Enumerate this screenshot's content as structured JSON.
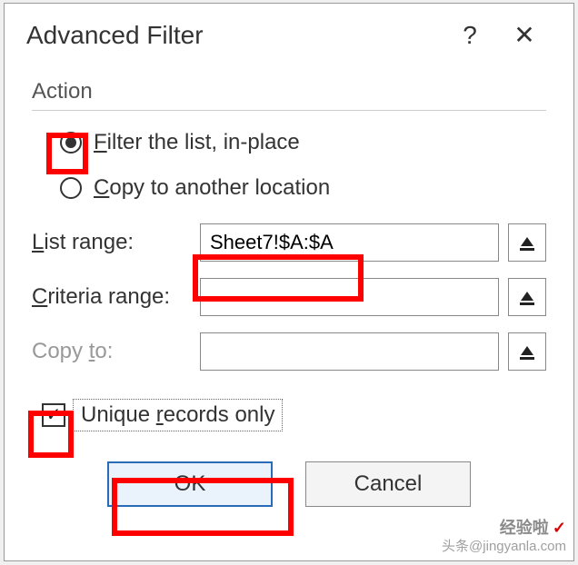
{
  "dialog": {
    "title": "Advanced Filter",
    "help_symbol": "?",
    "close_symbol": "✕"
  },
  "action": {
    "section_label": "Action",
    "filter_in_place": {
      "prefix": "F",
      "rest": "ilter the list, in-place",
      "selected": true
    },
    "copy_another": {
      "prefix": "C",
      "rest": "opy to another location",
      "selected": false
    }
  },
  "ranges": {
    "list": {
      "label_prefix": "L",
      "label_rest": "ist range:",
      "value": "Sheet7!$A:$A"
    },
    "criteria": {
      "label_prefix": "C",
      "label_rest": "riteria range:",
      "value": ""
    },
    "copyto": {
      "label_prefix": "Copy ",
      "label_underline": "t",
      "label_suffix": "o:",
      "value": ""
    }
  },
  "unique": {
    "checked": true,
    "pre": "Unique ",
    "underline": "r",
    "post": "ecords only"
  },
  "buttons": {
    "ok": "OK",
    "cancel": "Cancel"
  },
  "watermark": {
    "line1": "经验啦",
    "line2": "头条@jingyanla.com",
    "check": "✓"
  },
  "highlights": {
    "color": "#ff0000"
  }
}
